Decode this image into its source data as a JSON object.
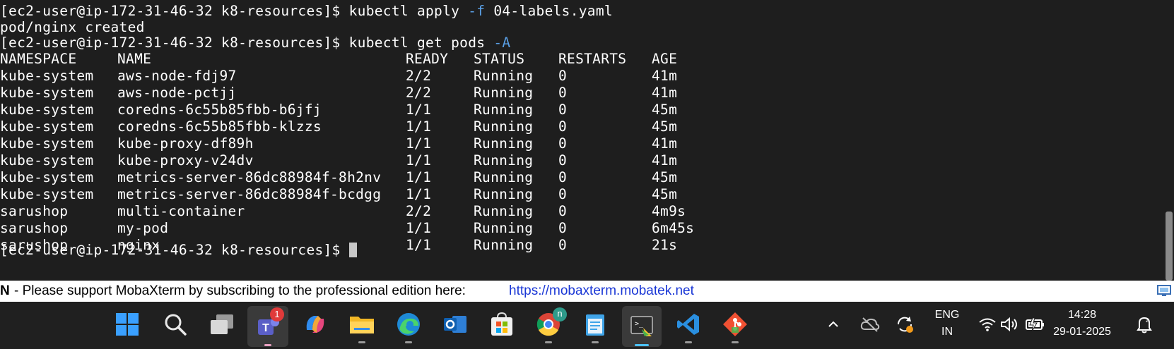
{
  "terminal": {
    "cmd1_prompt": "[ec2-user@ip-172-31-46-32 k8-resources]$ ",
    "cmd1_text": "kubectl apply ",
    "cmd1_flag": "-f",
    "cmd1_arg": " 04-labels.yaml",
    "output1": "pod/nginx created",
    "cmd2_prompt": "[ec2-user@ip-172-31-46-32 k8-resources]$ ",
    "cmd2_text": "kubectl get pods ",
    "cmd2_flag": "-A",
    "headers": [
      "NAMESPACE",
      "NAME",
      "READY",
      "STATUS",
      "RESTARTS",
      "AGE"
    ],
    "rows": [
      [
        "kube-system",
        "aws-node-fdj97",
        "2/2",
        "Running",
        "0",
        "41m"
      ],
      [
        "kube-system",
        "aws-node-pctjj",
        "2/2",
        "Running",
        "0",
        "41m"
      ],
      [
        "kube-system",
        "coredns-6c55b85fbb-b6jfj",
        "1/1",
        "Running",
        "0",
        "45m"
      ],
      [
        "kube-system",
        "coredns-6c55b85fbb-klzzs",
        "1/1",
        "Running",
        "0",
        "45m"
      ],
      [
        "kube-system",
        "kube-proxy-df89h",
        "1/1",
        "Running",
        "0",
        "41m"
      ],
      [
        "kube-system",
        "kube-proxy-v24dv",
        "1/1",
        "Running",
        "0",
        "41m"
      ],
      [
        "kube-system",
        "metrics-server-86dc88984f-8h2nv",
        "1/1",
        "Running",
        "0",
        "45m"
      ],
      [
        "kube-system",
        "metrics-server-86dc88984f-bcdgg",
        "1/1",
        "Running",
        "0",
        "45m"
      ],
      [
        "sarushop",
        "multi-container",
        "2/2",
        "Running",
        "0",
        "4m9s"
      ],
      [
        "sarushop",
        "my-pod",
        "1/1",
        "Running",
        "0",
        "6m45s"
      ],
      [
        "sarushop",
        "nginx",
        "1/1",
        "Running",
        "0",
        "21s"
      ]
    ],
    "final_prompt": "[ec2-user@ip-172-31-46-32 k8-resources]$ "
  },
  "banner": {
    "letter": "N",
    "message": " -  Please support MobaXterm by subscribing to the professional edition here:",
    "link": "https://mobaxterm.mobatek.net"
  },
  "taskbar": {
    "apps": [
      "start-icon",
      "search-icon",
      "task-view-icon",
      "teams-icon",
      "copilot-icon",
      "file-explorer-icon",
      "edge-icon",
      "outlook-icon",
      "store-icon",
      "chrome-icon",
      "notepad-icon",
      "mobaxterm-icon",
      "vscode-icon",
      "git-icon"
    ],
    "teams_badge": "1",
    "chrome_badge": "n",
    "lang_line1": "ENG",
    "lang_line2": "IN",
    "time": "14:28",
    "date": "29-01-2025"
  },
  "colors": {
    "terminal_bg": "#1e1e1e",
    "flag": "#5aa0e6",
    "link": "#1a37d6",
    "taskbar_bg": "#202020",
    "accent": "#4cc2ff"
  }
}
